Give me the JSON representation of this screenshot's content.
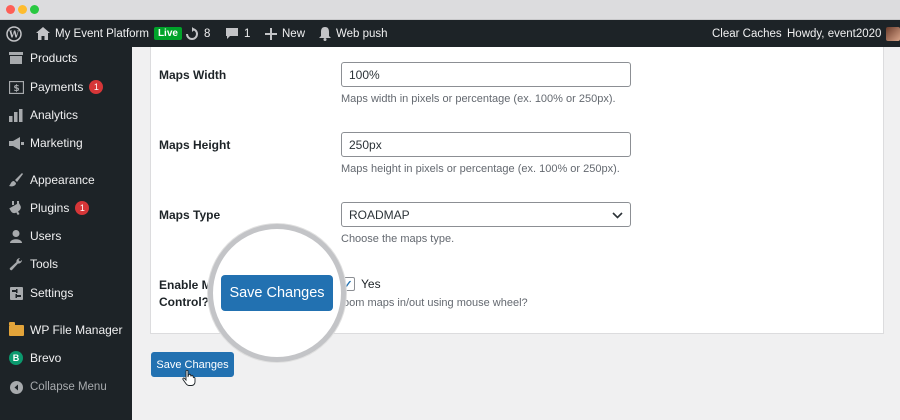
{
  "adminbar": {
    "site_name": "My Event Platform",
    "live_badge": "Live",
    "updates_count": "8",
    "comments_count": "1",
    "new_label": "New",
    "webpush_label": "Web push",
    "clear_caches": "Clear Caches",
    "howdy": "Howdy, event2020"
  },
  "sidebar": {
    "items": [
      {
        "label": "Products",
        "icon": "products-icon"
      },
      {
        "label": "Payments",
        "icon": "payments-icon",
        "badge": "1"
      },
      {
        "label": "Analytics",
        "icon": "analytics-icon"
      },
      {
        "label": "Marketing",
        "icon": "marketing-icon"
      },
      {
        "label": "Appearance",
        "icon": "appearance-icon"
      },
      {
        "label": "Plugins",
        "icon": "plugins-icon",
        "badge": "1"
      },
      {
        "label": "Users",
        "icon": "users-icon"
      },
      {
        "label": "Tools",
        "icon": "tools-icon"
      },
      {
        "label": "Settings",
        "icon": "settings-icon"
      },
      {
        "label": "WP File Manager",
        "icon": "folder-icon"
      },
      {
        "label": "Brevo",
        "icon": "brevo-icon",
        "icon_letter": "B"
      },
      {
        "label": "Collapse Menu",
        "icon": "collapse-icon"
      }
    ]
  },
  "form": {
    "maps_width": {
      "label": "Maps Width",
      "value": "100%",
      "description": "Maps width in pixels or percentage (ex. 100% or 250px)."
    },
    "maps_height": {
      "label": "Maps Height",
      "value": "250px",
      "description": "Maps height in pixels or percentage (ex. 100% or 250px)."
    },
    "maps_type": {
      "label": "Maps Type",
      "value": "ROADMAP",
      "description": "Choose the maps type."
    },
    "mouse_control": {
      "label_line1": "Enable M",
      "label_line2": "Control?",
      "checkbox_label": "Yes",
      "checked": true,
      "description": "oom maps in/out using mouse wheel?"
    }
  },
  "save_button": "Save Changes",
  "magnifier_button": "Save Changes",
  "colors": {
    "primary": "#2271b1",
    "admin_dark": "#1d2327",
    "badge_red": "#d63638",
    "live_green": "#00a32a"
  }
}
